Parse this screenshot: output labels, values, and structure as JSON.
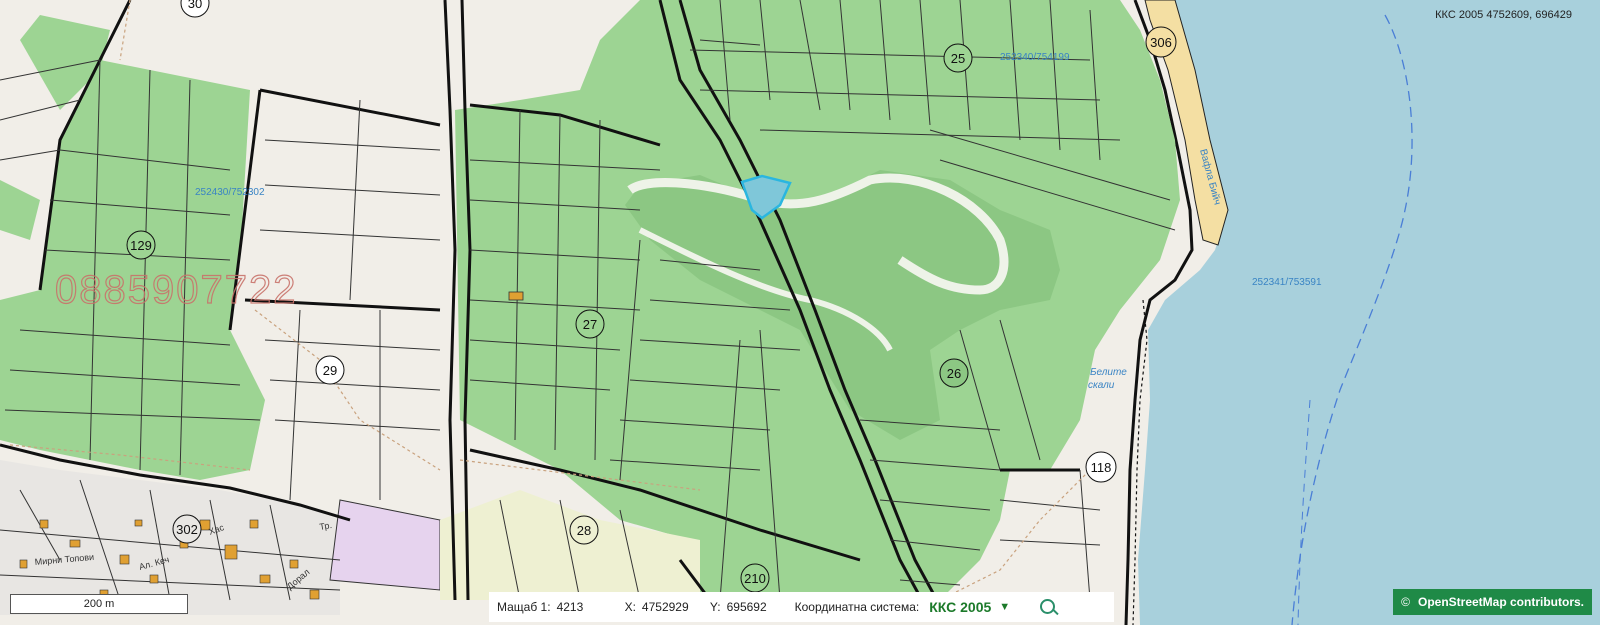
{
  "top_coords": "ККС 2005 4752609, 696429",
  "labels": {
    "l30": "30",
    "l306": "306",
    "l25": "25",
    "l129": "129",
    "l27": "27",
    "l29": "29",
    "l26": "26",
    "l118": "118",
    "l28": "28",
    "l302": "302",
    "l210": "210"
  },
  "ref_labels": {
    "a": "252430/752302",
    "b": "252340/754199",
    "c": "252341/753591",
    "beach": "Вафла Бийч",
    "cliffs_1": "Белите",
    "cliffs_2": "скали"
  },
  "street_labels": {
    "s1": "Мирни Топови",
    "s2": "Ал. Кеч",
    "s3": "Хас",
    "s4": "Дорал",
    "s5": "Тр."
  },
  "watermark": "0885907722",
  "scale_bar": "200 m",
  "toolbar": {
    "scale_label": "Мащаб 1:",
    "scale_value": "4213",
    "x_label": "X:",
    "x_value": "4752929",
    "y_label": "Y:",
    "y_value": "695692",
    "crs_label": "Координатна система:",
    "crs_value": "ККС 2005"
  },
  "attribution": {
    "symbol": "©",
    "text": "OpenStreetMap contributors."
  },
  "colors": {
    "sea": "#a8d0dc",
    "land": "#f1eee8",
    "parcel_green": "#9dd493",
    "forest_green": "#8cc783",
    "beach": "#f4dfa3",
    "selected": "#2ab6e0"
  }
}
